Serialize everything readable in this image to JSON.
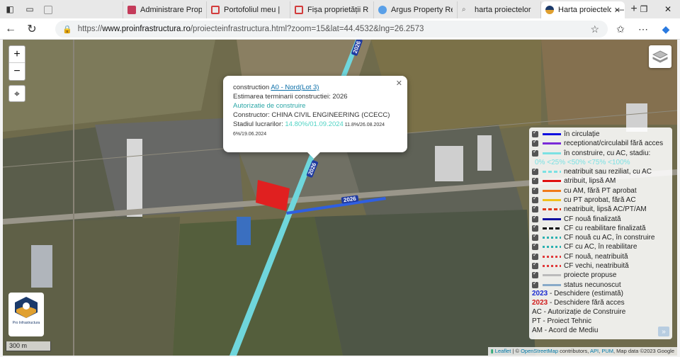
{
  "browser": {
    "tabs": [
      {
        "label": "",
        "favicon_color": "#9a9a9a"
      },
      {
        "label": "Administrare Prop",
        "favicon_color": "#c43b5a"
      },
      {
        "label": "Portofoliul meu | ",
        "favicon_color": "#d23b3b"
      },
      {
        "label": "Fișa proprietății R",
        "favicon_color": "#d23b3b"
      },
      {
        "label": "Argus Property Re",
        "favicon_color": "#5aa0e8"
      },
      {
        "label": "harta proiectelor",
        "favicon_color": "#777777"
      },
      {
        "label": "Harta proiectelor",
        "favicon_color": "#e0a030"
      }
    ],
    "address": {
      "prefix": "https://",
      "domain": "www.proinfrastructura.ro",
      "path": "/proiecteinfrastructura.html?zoom=15&lat=44.4532&lng=26.2573"
    }
  },
  "map": {
    "zoom_in": "+",
    "zoom_out": "−",
    "road_labels": [
      "2026",
      "2026",
      "2026"
    ],
    "popup": {
      "line1_prefix": "construction ",
      "line1_link": "A0 - Nord(Lot 3)",
      "estimate": "Estimarea terminarii constructiei: 2026",
      "authorization": "Autorizatie de construire",
      "constructor": "Constructor: CHINA CIVIL ENGINEERING (CCECC)",
      "status_prefix": "Stadiul lucrarilor: ",
      "status_main": "14.80%/01.09.2024",
      "status_a": " 11.8%/26.08.2024",
      "status_b": "6%/19.06.2024"
    },
    "legend": {
      "rows": [
        {
          "label": "în circulație",
          "color": "#1010e0",
          "style": "solid"
        },
        {
          "label": "receptionat/circulabil fără acces",
          "color": "#7a2ad8",
          "style": "solid"
        },
        {
          "label": "în construire, cu AC, stadiu:",
          "color": "#7be1e3",
          "style": "solid"
        },
        {
          "label": "neatribuit sau reziliat, cu AC",
          "color": "#7be1e3",
          "style": "dashed"
        },
        {
          "label": "atribuit, lipsă AM",
          "color": "#e01010",
          "style": "solid"
        },
        {
          "label": "cu AM, fără PT aprobat",
          "color": "#f07a1a",
          "style": "solid"
        },
        {
          "label": "cu PT aprobat, fără AC",
          "color": "#f0c01a",
          "style": "solid"
        },
        {
          "label": "neatribuit, lipsă AC/PT/AM",
          "color": "#e03a1a",
          "style": "dashed"
        },
        {
          "label": "CF nouă finalizată",
          "color": "#1010a0",
          "style": "solid"
        },
        {
          "label": "CF cu reabilitare finalizată",
          "color": "#111111",
          "style": "rail"
        },
        {
          "label": "CF nouă cu AC, în construire",
          "color": "#2ab0b0",
          "style": "dashed"
        },
        {
          "label": "CF cu AC, în reabilitare",
          "color": "#2ab0b0",
          "style": "dashed"
        },
        {
          "label": "CF nouă, neatribuită",
          "color": "#e03a3a",
          "style": "dashed"
        },
        {
          "label": "CF vechi, neatribuită",
          "color": "#e03a3a",
          "style": "dashed"
        },
        {
          "label": "proiecte propuse",
          "color": "#bbbbbb",
          "style": "solid"
        },
        {
          "label": "status necunoscut",
          "color": "#88aac8",
          "style": "solid"
        }
      ],
      "stages": "0% <25% <50% <75% <100%",
      "notes": [
        {
          "year": "2023",
          "year_color": "#1a2ad0",
          "text": " - Deschidere (estimată)"
        },
        {
          "year": "2023",
          "year_color": "#d01a1a",
          "text": " - Deschidere fără acces"
        }
      ],
      "abbrev": [
        "AC - Autorizație de Construire",
        "PT - Proiect Tehnic",
        "AM - Acord de Mediu"
      ],
      "expand_icon": "»"
    },
    "logo_text": "Pro Infrastructura",
    "scale": "300 m",
    "attribution": {
      "leaflet": "Leaflet",
      "sep1": " | © ",
      "osm": "OpenStreetMap",
      "rest": " contributors, ",
      "api": "API",
      "sep2": ", ",
      "pum": "PUM",
      "tail": ", Map data ©2023 Google"
    }
  }
}
